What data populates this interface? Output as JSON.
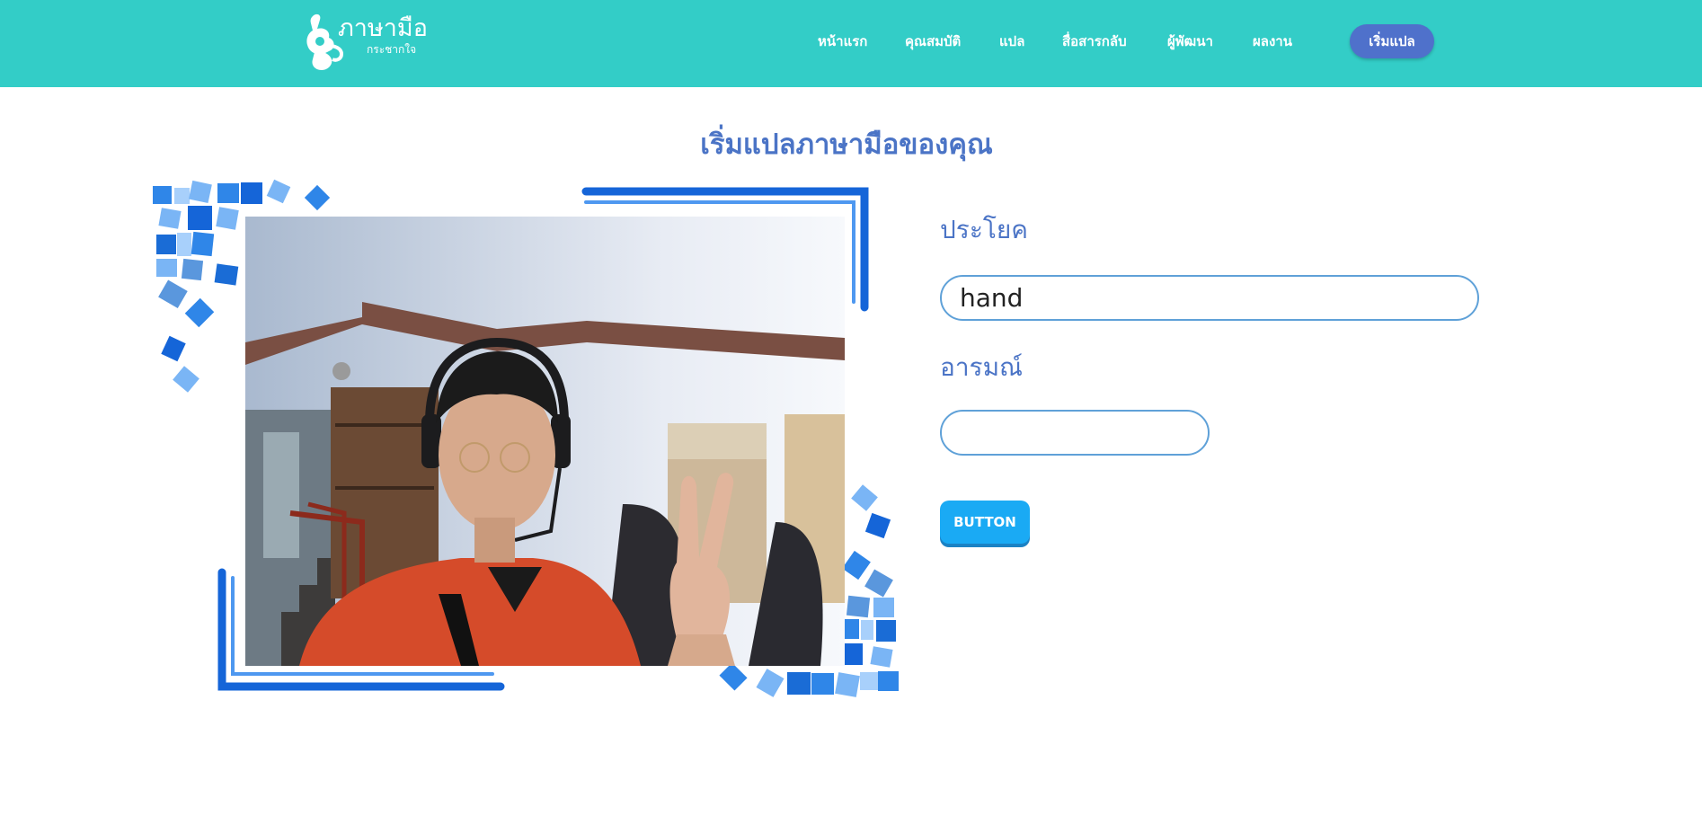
{
  "brand": {
    "title": "ภาษามือ",
    "subtitle": "กระชากใจ"
  },
  "nav": {
    "items": [
      {
        "label": "หน้าแรก"
      },
      {
        "label": "คุณสมบัติ"
      },
      {
        "label": "แปล"
      },
      {
        "label": "สื่อสารกลับ"
      },
      {
        "label": "ผู้พัฒนา"
      },
      {
        "label": "ผลงาน"
      }
    ],
    "cta_label": "เริ่มแปล"
  },
  "main": {
    "heading": "เริ่มแปลภาษามือของคุณ",
    "sentence": {
      "label": "ประโยค",
      "value": "hand"
    },
    "emotion": {
      "label": "อารมณ์",
      "value": ""
    },
    "button_label": "BUTTON"
  },
  "colors": {
    "navbar": "#33cdc7",
    "heading": "#4b74c6",
    "cta": "#4f71cb",
    "button": "#1aaaf4",
    "frame": "#1565d8"
  },
  "icons": {
    "logo": "sign-language-hands-icon"
  }
}
